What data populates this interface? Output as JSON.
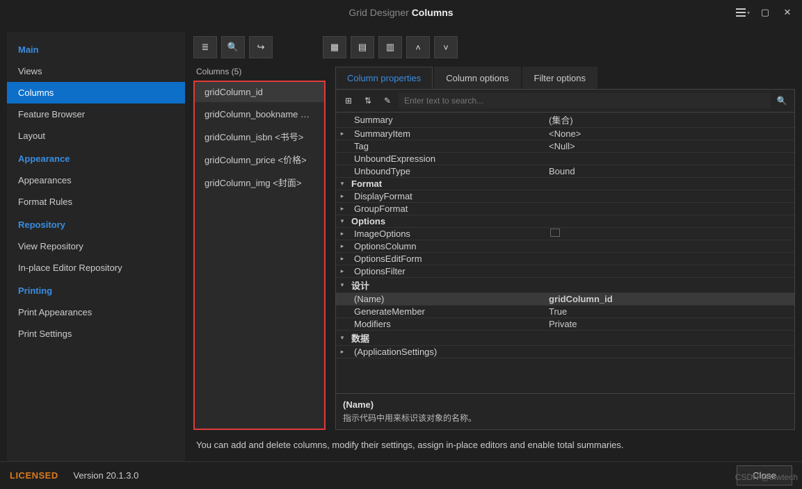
{
  "title": {
    "light": "Grid Designer",
    "bold": "Columns"
  },
  "titlebar_icons": {
    "grid": "grid",
    "dropdown": "▾",
    "maximize": "▢",
    "close": "✕"
  },
  "sidebar": {
    "sections": [
      {
        "header": "Main",
        "items": [
          {
            "label": "Views",
            "active": false
          },
          {
            "label": "Columns",
            "active": true
          },
          {
            "label": "Feature Browser",
            "active": false
          },
          {
            "label": "Layout",
            "active": false
          }
        ]
      },
      {
        "header": "Appearance",
        "items": [
          {
            "label": "Appearances",
            "active": false
          },
          {
            "label": "Format Rules",
            "active": false
          }
        ]
      },
      {
        "header": "Repository",
        "items": [
          {
            "label": "View Repository",
            "active": false
          },
          {
            "label": "In-place Editor Repository",
            "active": false
          }
        ]
      },
      {
        "header": "Printing",
        "items": [
          {
            "label": "Print Appearances",
            "active": false
          },
          {
            "label": "Print Settings",
            "active": false
          }
        ]
      }
    ]
  },
  "toolbar_icons": {
    "list": "≣",
    "search": "🔍",
    "export": "↪",
    "t1": "▦",
    "t2": "▤",
    "t3": "▥",
    "up": "˄",
    "down": "˅"
  },
  "columns": {
    "header": "Columns (5)",
    "items": [
      {
        "label": "gridColumn_id",
        "selected": true
      },
      {
        "label": "gridColumn_bookname <书名",
        "selected": false
      },
      {
        "label": "gridColumn_isbn <书号>",
        "selected": false
      },
      {
        "label": "gridColumn_price <价格>",
        "selected": false
      },
      {
        "label": "gridColumn_img <封面>",
        "selected": false
      }
    ]
  },
  "tabs": [
    {
      "label": "Column properties",
      "active": true
    },
    {
      "label": "Column options",
      "active": false
    },
    {
      "label": "Filter options",
      "active": false
    }
  ],
  "prop_toolbar": {
    "b1": "⊞",
    "b2": "⇅",
    "b3": "✎",
    "search_placeholder": "Enter text to search...",
    "search_icon": "🔍"
  },
  "props": [
    {
      "type": "row",
      "name": "Summary",
      "value": "(集合)"
    },
    {
      "type": "row",
      "name": "SummaryItem",
      "value": "<None>",
      "exp": "▸"
    },
    {
      "type": "row",
      "name": "Tag",
      "value": "<Null>"
    },
    {
      "type": "row",
      "name": "UnboundExpression",
      "value": ""
    },
    {
      "type": "row",
      "name": "UnboundType",
      "value": "Bound"
    },
    {
      "type": "cat",
      "name": "Format",
      "exp": "▾"
    },
    {
      "type": "row",
      "name": "DisplayFormat",
      "value": "",
      "exp": "▸"
    },
    {
      "type": "row",
      "name": "GroupFormat",
      "value": "",
      "exp": "▸"
    },
    {
      "type": "cat",
      "name": "Options",
      "exp": "▾"
    },
    {
      "type": "row",
      "name": "ImageOptions",
      "value": "",
      "exp": "▸",
      "checkbox": true
    },
    {
      "type": "row",
      "name": "OptionsColumn",
      "value": "",
      "exp": "▸"
    },
    {
      "type": "row",
      "name": "OptionsEditForm",
      "value": "",
      "exp": "▸"
    },
    {
      "type": "row",
      "name": "OptionsFilter",
      "value": "",
      "exp": "▸"
    },
    {
      "type": "cat",
      "name": "设计",
      "exp": "▾"
    },
    {
      "type": "row",
      "name": "(Name)",
      "value": "gridColumn_id",
      "sel": true
    },
    {
      "type": "row",
      "name": "GenerateMember",
      "value": "True"
    },
    {
      "type": "row",
      "name": "Modifiers",
      "value": "Private"
    },
    {
      "type": "cat",
      "name": "数据",
      "exp": "▾"
    },
    {
      "type": "row",
      "name": "(ApplicationSettings)",
      "value": "",
      "exp": "▸"
    }
  ],
  "help": {
    "title": "(Name)",
    "text": "指示代码中用来标识该对象的名称。"
  },
  "hint": "You can add and delete columns, modify their settings, assign in-place editors and enable total summaries.",
  "footer": {
    "licensed": "LICENSED",
    "version": "Version 20.1.3.0",
    "close": "Close",
    "watermark": "CSDN @txwtech"
  }
}
